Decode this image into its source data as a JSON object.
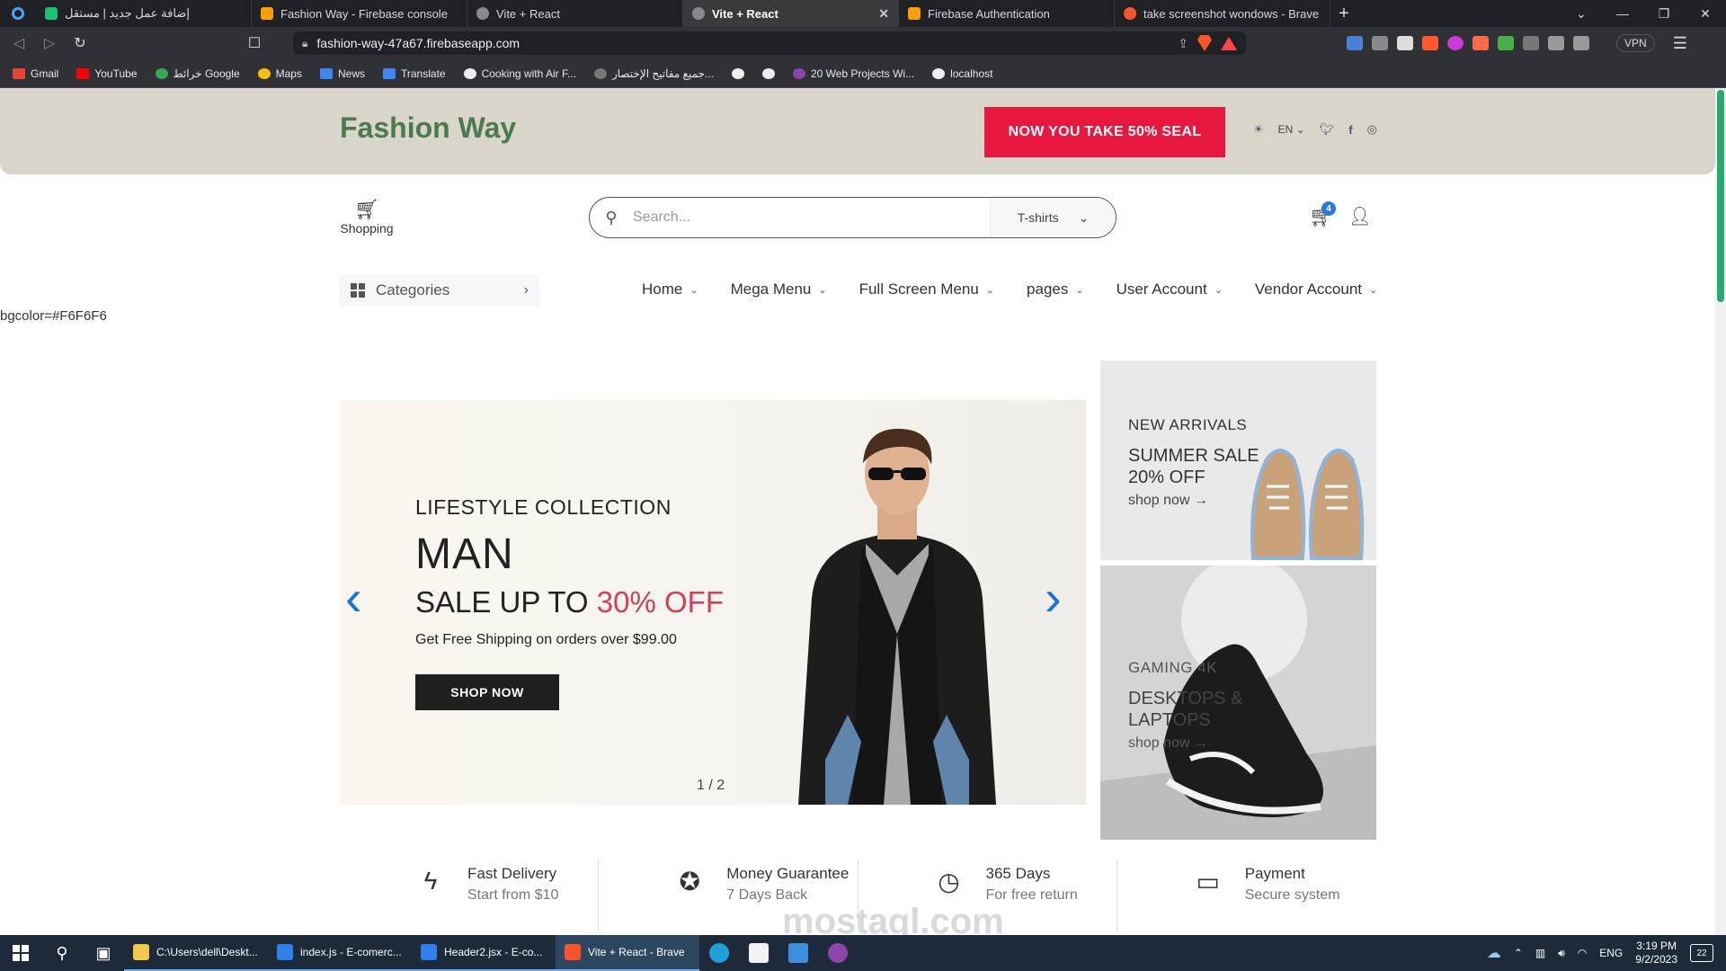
{
  "browser": {
    "tabs": [
      {
        "label": "إضافة عمل جديد | مستقل",
        "color": "#1dbf73",
        "active": false
      },
      {
        "label": "Fashion Way - Firebase console",
        "color": "#ffa000",
        "active": false
      },
      {
        "label": "Vite + React",
        "color": "#8a8a8a",
        "active": false
      },
      {
        "label": "Vite + React",
        "color": "#8a8a8a",
        "active": true
      },
      {
        "label": "Firebase Authentication",
        "color": "#ffa000",
        "active": false
      },
      {
        "label": "take screenshot wondows - Brave Search",
        "color": "#fb542b",
        "active": false
      }
    ],
    "url": "fashion-way-47a67.firebaseapp.com",
    "vpn_label": "VPN",
    "bookmarks": [
      {
        "label": "Gmail",
        "color": "#ea4335"
      },
      {
        "label": "YouTube",
        "color": "#ff0000"
      },
      {
        "label": "خرائط Google",
        "color": "#34a853"
      },
      {
        "label": "Maps",
        "color": "#fbbc05"
      },
      {
        "label": "News",
        "color": "#4285f4"
      },
      {
        "label": "Translate",
        "color": "#4285f4"
      },
      {
        "label": "Cooking with Air F...",
        "color": "#eeeeee"
      },
      {
        "label": "جميع مفاتيح الإختصار...",
        "color": "#777777"
      },
      {
        "label": "",
        "color": "#eeeeee"
      },
      {
        "label": "",
        "color": "#eeeeee"
      },
      {
        "label": "20 Web Projects Wi...",
        "color": "#8e44ad"
      },
      {
        "label": "localhost",
        "color": "#eeeeee"
      }
    ]
  },
  "site": {
    "brand": "Fashion Way",
    "promo": "NOW YOU TAKE 50% SEAL",
    "lang": "EN",
    "shopping_label": "Shopping",
    "search": {
      "placeholder": "Search...",
      "category": "T-shirts"
    },
    "cart_count": "4",
    "categories_label": "Categories",
    "nav": [
      "Home",
      "Mega Menu",
      "Full Screen Menu",
      "pages",
      "User Account",
      "Vendor Account"
    ],
    "bg_note": "bgcolor=#F6F6F6",
    "hero": {
      "subtitle": "LIFESTYLE COLLECTION",
      "title": "MAN",
      "sale_prefix": "SALE UP TO ",
      "sale_accent": "30% OFF",
      "shipping": "Get Free Shipping on orders over $99.00",
      "button": "SHOP NOW",
      "counter": "1 / 2"
    },
    "card_top": {
      "kicker": "NEW ARRIVALS",
      "heading": "SUMMER SALE 20% OFF",
      "link": "shop now →"
    },
    "card_bottom": {
      "kicker": "GAMING 4K",
      "heading": "DESKTOPS & LAPTOPS",
      "link": "shop now →"
    },
    "features": [
      {
        "title": "Fast Delivery",
        "sub": "Start from $10",
        "icon": "bolt-icon"
      },
      {
        "title": "Money Guarantee",
        "sub": "7 Days Back",
        "icon": "award-icon"
      },
      {
        "title": "365 Days",
        "sub": "For free return",
        "icon": "clock-icon"
      },
      {
        "title": "Payment",
        "sub": "Secure system",
        "icon": "card-icon"
      }
    ],
    "watermark": "mostaql.com",
    "colors": {
      "accent": "#d23f57",
      "promo": "#e8173e",
      "brand": "#4d7a4d",
      "slider_arrow": "#1a73d6"
    }
  },
  "taskbar": {
    "apps": [
      {
        "label": "C:\\Users\\dell\\Deskt...",
        "color": "#f2c94c",
        "active": false
      },
      {
        "label": "index.js - E-comerc...",
        "color": "#2f80ed",
        "active": false
      },
      {
        "label": "Header2.jsx - E-co...",
        "color": "#2f80ed",
        "active": false
      },
      {
        "label": "Vite + React - Brave",
        "color": "#fb542b",
        "active": true
      }
    ],
    "lang": "ENG",
    "time": "3:19 PM",
    "date": "9/2/2023",
    "notifications": "22"
  }
}
